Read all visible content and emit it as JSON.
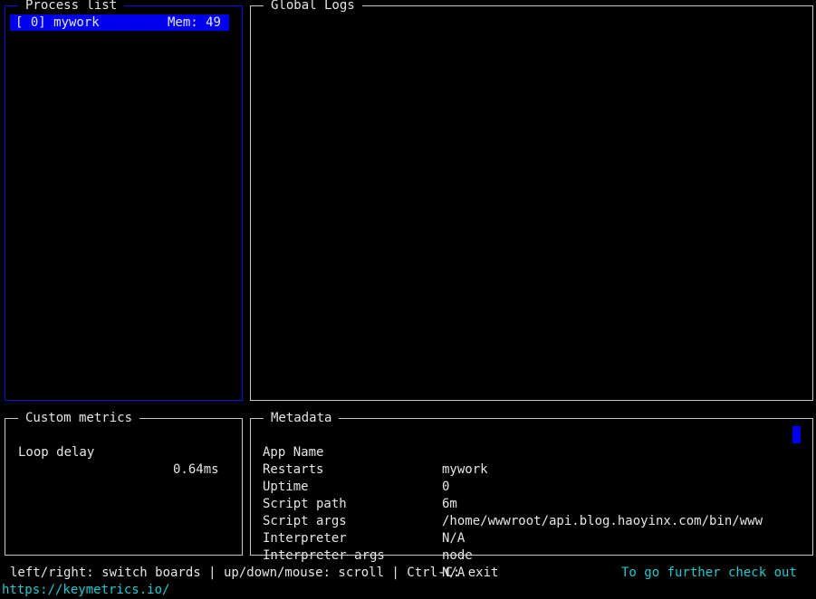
{
  "process_list": {
    "title": "Process list",
    "items": [
      {
        "label": "[ 0] mywork",
        "mem": "Mem:  49"
      }
    ]
  },
  "global_logs": {
    "title": "Global Logs"
  },
  "custom_metrics": {
    "title": "Custom metrics",
    "items": [
      {
        "label": "Loop delay",
        "value": "0.64ms"
      }
    ]
  },
  "metadata": {
    "title": "Metadata",
    "rows": [
      {
        "key": "App Name",
        "value": "mywork"
      },
      {
        "key": "Restarts",
        "value": "0"
      },
      {
        "key": "Uptime",
        "value": "6m"
      },
      {
        "key": "Script path",
        "value": "/home/wwwroot/api.blog.haoyinx.com/bin/www"
      },
      {
        "key": "Script args",
        "value": "N/A"
      },
      {
        "key": "Interpreter",
        "value": "node"
      },
      {
        "key": "Interpreter args",
        "value": "N/A"
      }
    ]
  },
  "footer": {
    "help": "left/right: switch boards | up/down/mouse: scroll | Ctrl-C: exit",
    "promo": "To go further check out",
    "link": "https://keymetrics.io/"
  },
  "colors": {
    "focus_border": "#1010d8",
    "selection": "#0000ee",
    "link": "#22c8d0"
  }
}
